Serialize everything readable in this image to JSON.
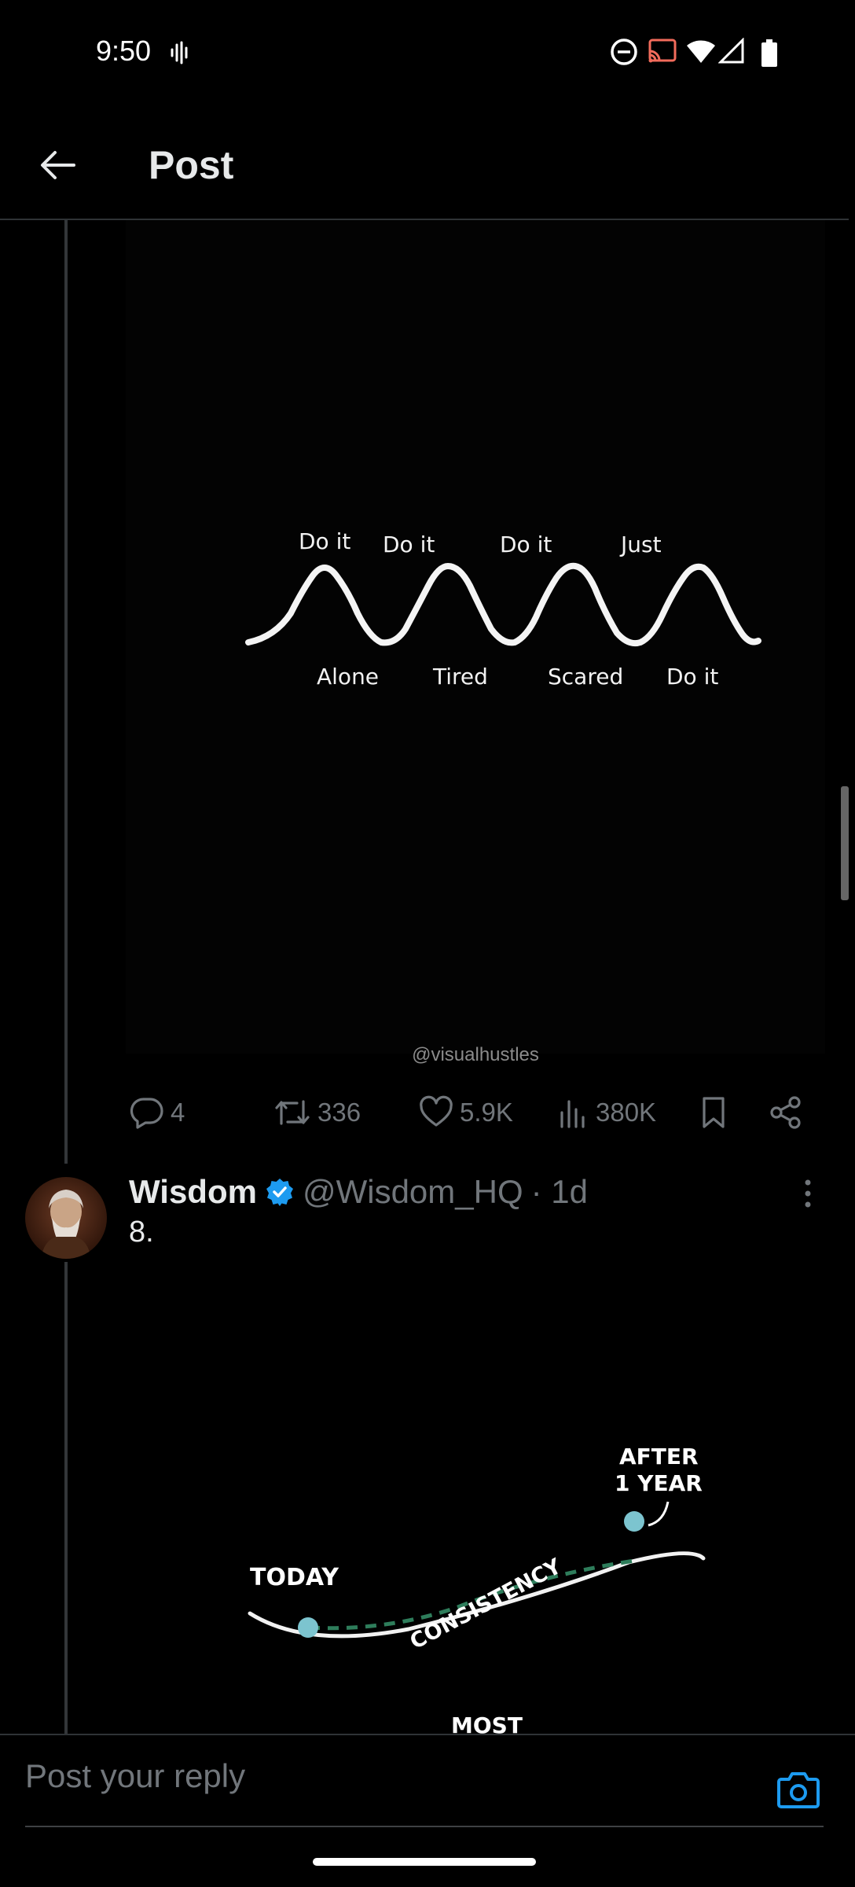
{
  "status_bar": {
    "time": "9:50"
  },
  "header": {
    "title": "Post"
  },
  "post_media": {
    "labels_top": [
      "Do it",
      "Do it",
      "Do it",
      "Just"
    ],
    "labels_bottom": [
      "Alone",
      "Tired",
      "Scared",
      "Do it"
    ],
    "watermark": "@visualhustles"
  },
  "actions": {
    "replies": "4",
    "reposts": "336",
    "likes": "5.9K",
    "views": "380K"
  },
  "reply": {
    "name": "Wisdom",
    "handle": "@Wisdom_HQ",
    "time": "· 1d",
    "text": "8."
  },
  "reply_media": {
    "label_today": "TODAY",
    "label_after_line1": "AFTER",
    "label_after_line2": "1 YEAR",
    "label_curve": "CONSISTENCY",
    "label_cut": "MOST"
  },
  "reply_bar": {
    "placeholder": "Post your reply"
  },
  "colors": {
    "accent": "#1d9bf0",
    "muted": "#71767b",
    "dot": "#7cc4cf",
    "dashed": "#2e7d5b"
  }
}
